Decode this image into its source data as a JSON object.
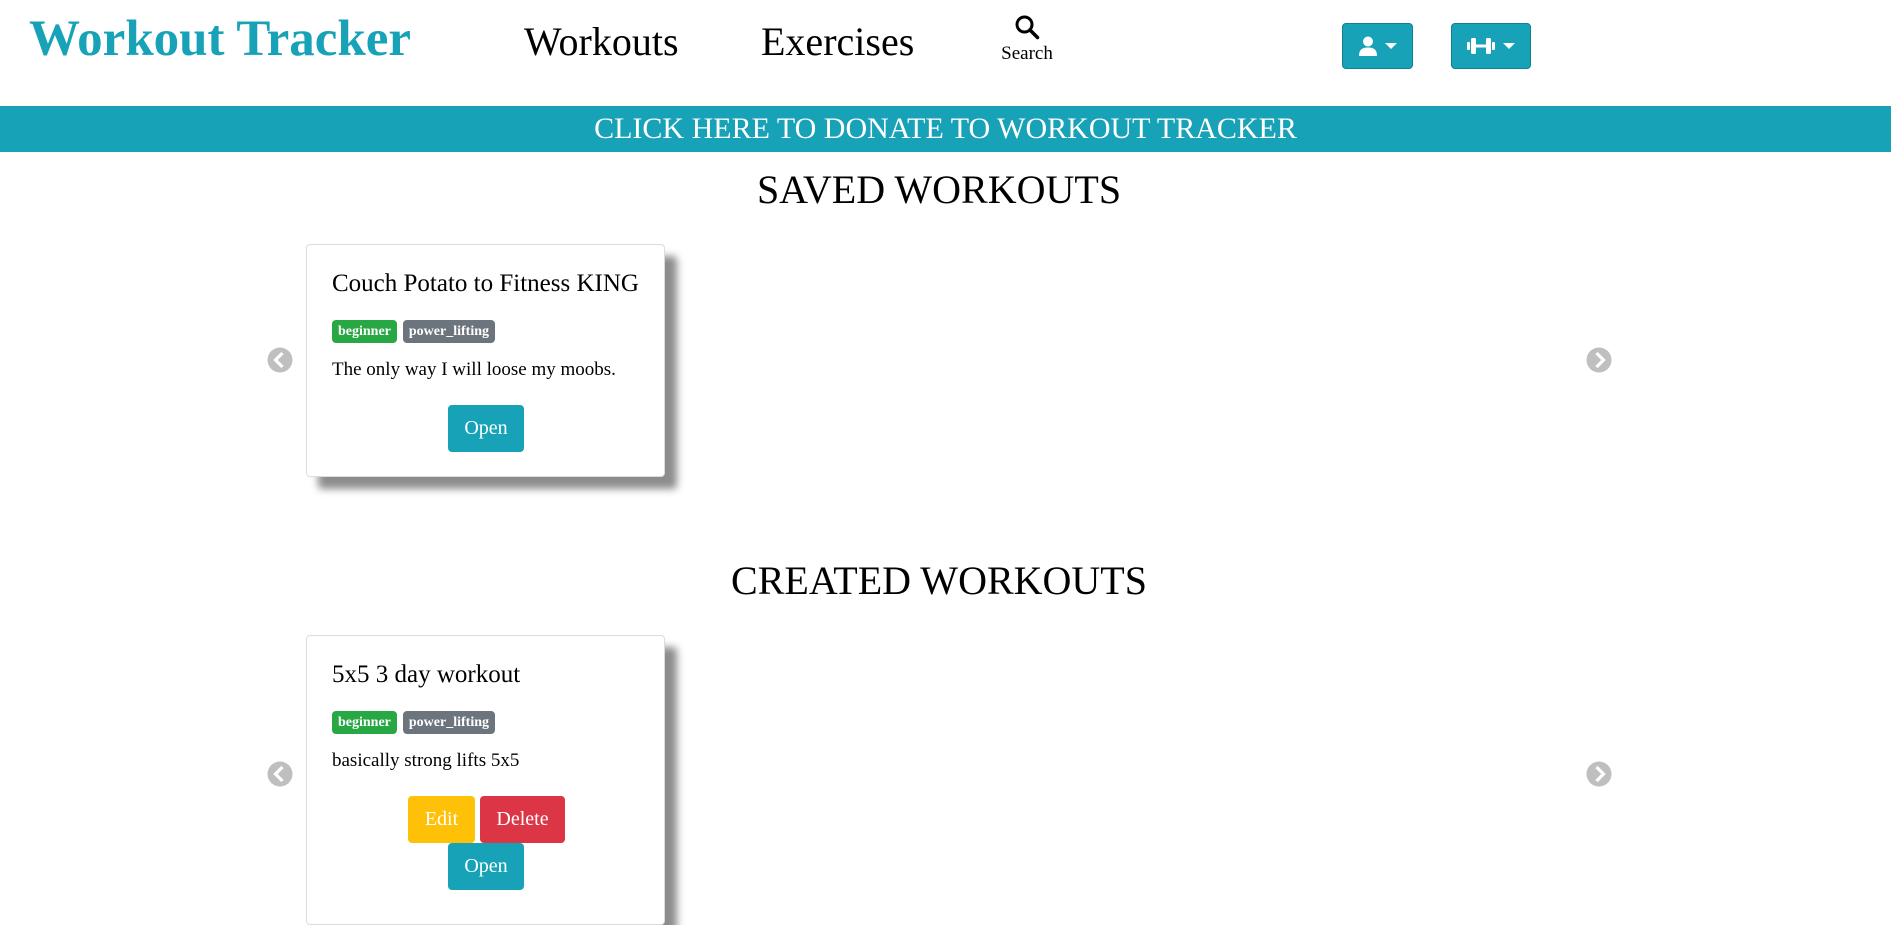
{
  "header": {
    "brand": "Workout Tracker",
    "nav": {
      "workouts": "Workouts",
      "exercises": "Exercises"
    },
    "search": {
      "label": "Search",
      "icon": "search-icon"
    },
    "user_menu": {
      "icon": "user-icon"
    },
    "workout_menu": {
      "icon": "dumbbell-icon"
    },
    "accent_color": "#17a2b8"
  },
  "banner": {
    "text": "CLICK HERE TO DONATE TO WORKOUT TRACKER"
  },
  "saved": {
    "title": "SAVED WORKOUTS",
    "cards": [
      {
        "title": "Couch Potato to Fitness KING",
        "tags": [
          "beginner",
          "power_lifting"
        ],
        "description": "The only way I will loose my moobs.",
        "open_label": "Open"
      }
    ]
  },
  "created": {
    "title": "CREATED WORKOUTS",
    "cards": [
      {
        "title": "5x5 3 day workout",
        "tags": [
          "beginner",
          "power_lifting"
        ],
        "description": "basically strong lifts 5x5",
        "edit_label": "Edit",
        "delete_label": "Delete",
        "open_label": "Open"
      }
    ]
  },
  "colors": {
    "primary": "#17a2b8",
    "success": "#28a745",
    "secondary": "#6c757d",
    "warning": "#ffc107",
    "danger": "#dc3545"
  }
}
